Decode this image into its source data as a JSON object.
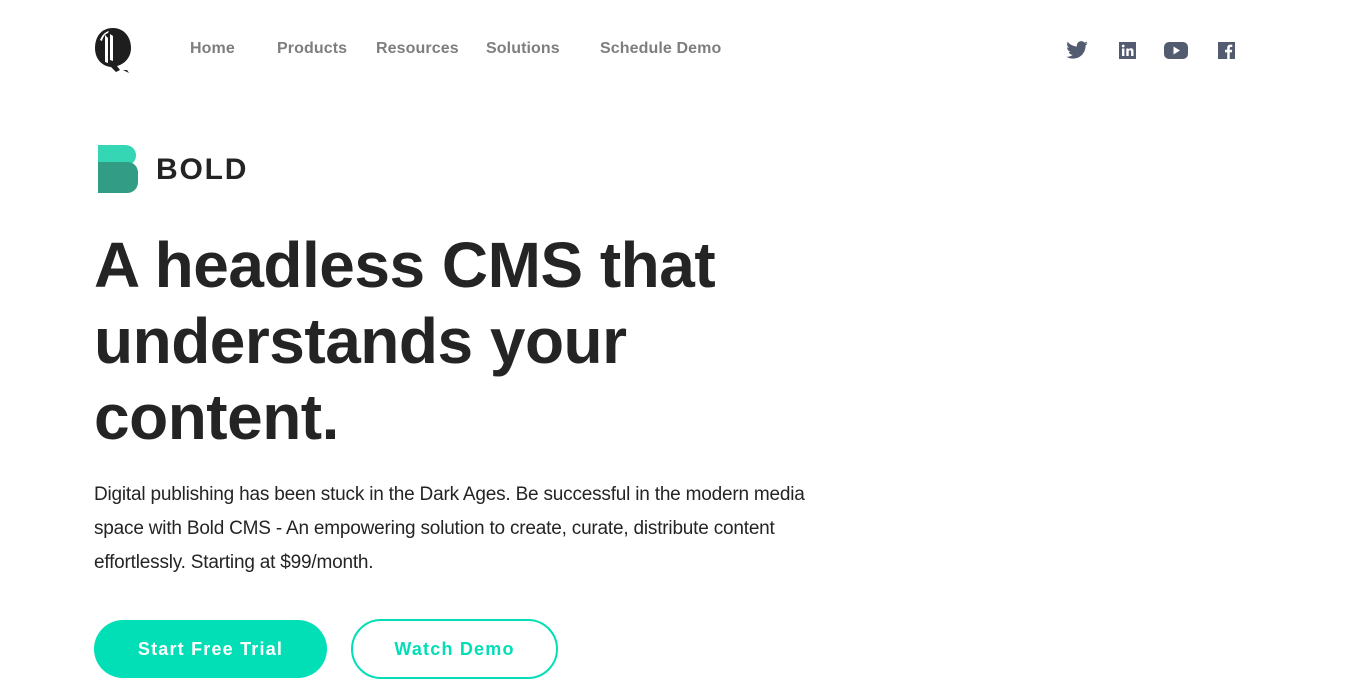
{
  "header": {
    "logo_icon": "fraktur-q-logo",
    "nav": [
      {
        "label": "Home"
      },
      {
        "label": "Products"
      },
      {
        "label": "Resources"
      },
      {
        "label": "Solutions"
      },
      {
        "label": "Schedule Demo"
      }
    ],
    "social": [
      {
        "name": "twitter-icon"
      },
      {
        "name": "linkedin-icon"
      },
      {
        "name": "youtube-icon"
      },
      {
        "name": "facebook-icon"
      }
    ],
    "icon_color": "#535b70"
  },
  "brand": {
    "name": "BOLD",
    "mark_top_color": "#35d6b4",
    "mark_bottom_color": "#339c84"
  },
  "hero": {
    "title": "A headless CMS that understands your content.",
    "description": "Digital publishing has been stuck in the Dark Ages. Be successful in the modern media space with Bold CMS - An empowering solution to create, curate, distribute content effortlessly. Starting at $99/month.",
    "primary_cta": "Start Free Trial",
    "secondary_cta": "Watch Demo",
    "accent_color": "#02dfb7"
  }
}
